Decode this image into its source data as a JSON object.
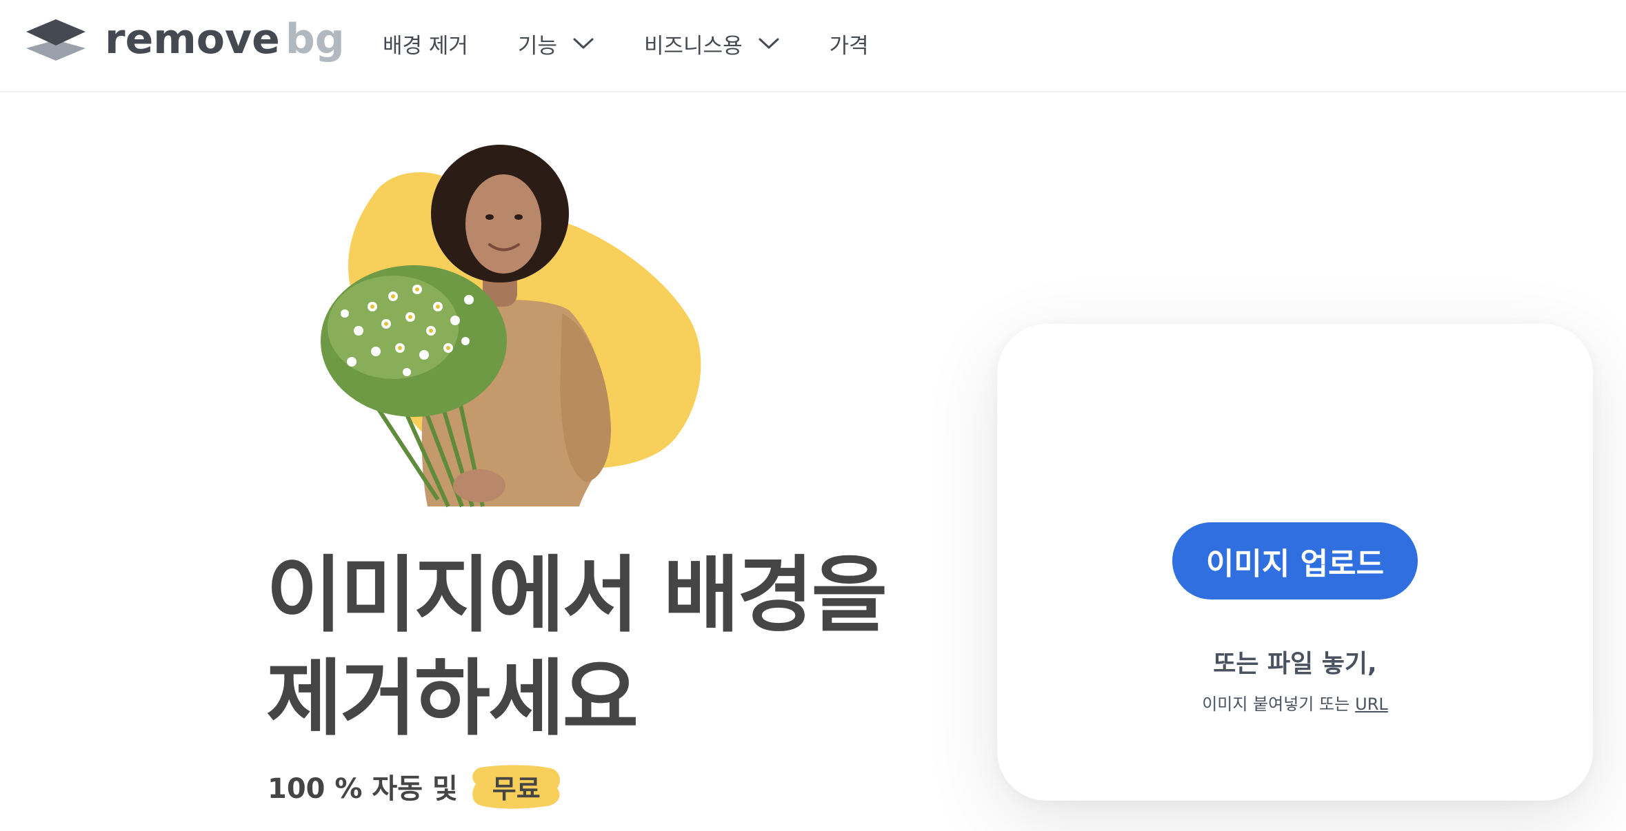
{
  "header": {
    "logo": {
      "word1": "remove",
      "word2": "bg"
    },
    "nav": [
      {
        "label": "배경 제거",
        "has_dropdown": false
      },
      {
        "label": "기능",
        "has_dropdown": true
      },
      {
        "label": "비즈니스용",
        "has_dropdown": true
      },
      {
        "label": "가격",
        "has_dropdown": false
      }
    ]
  },
  "hero": {
    "title": "이미지에서 배경을 제거하세요",
    "subtitle": "100 % 자동 및",
    "badge": "무료"
  },
  "upload": {
    "button_label": "이미지 업로드",
    "drop_title": "또는 파일 놓기,",
    "drop_sub": "이미지 붙여넣기 또는",
    "url_link": "URL"
  },
  "colors": {
    "accent_blue": "#2f6fdf",
    "brand_yellow": "#f7cf5a",
    "text_dark": "#454545",
    "logo_gray": "#b2b8bf"
  }
}
